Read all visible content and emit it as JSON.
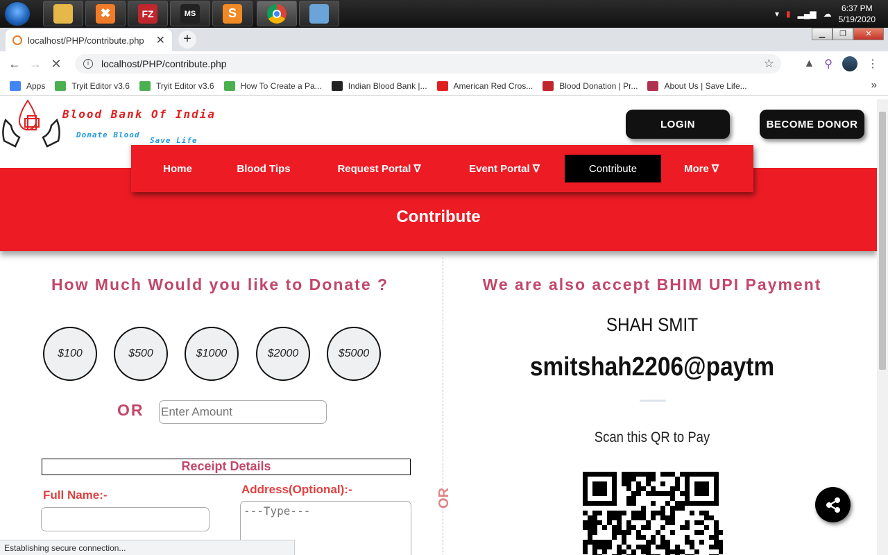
{
  "taskbar": {
    "apps": [
      {
        "name": "file-explorer-icon",
        "color": "#e6b84a"
      },
      {
        "name": "xampp-icon",
        "color": "#f07b28",
        "glyph": "✖"
      },
      {
        "name": "filezilla-icon",
        "color": "#c0272d",
        "glyph": "FZ"
      },
      {
        "name": "msoffice-tc-icon",
        "color": "#222222",
        "glyph": "MS"
      },
      {
        "name": "sublime-text-icon",
        "color": "#3a3a3a",
        "glyph": "S"
      },
      {
        "name": "chrome-icon",
        "color": "#4285f4"
      },
      {
        "name": "paint-icon",
        "color": "#6aa4d8"
      }
    ],
    "time": "6:37 PM",
    "date": "5/19/2020"
  },
  "browser": {
    "tab_title": "localhost/PHP/contribute.php",
    "url": "localhost/PHP/contribute.php",
    "bookmarks": [
      {
        "label": "Apps",
        "icon": "apps-grid-icon",
        "color": "#4285f4"
      },
      {
        "label": "Tryit Editor v3.6",
        "icon": "w3schools-icon",
        "color": "#4caf50"
      },
      {
        "label": "Tryit Editor v3.6",
        "icon": "w3schools-icon",
        "color": "#4caf50"
      },
      {
        "label": "How To Create a Pa...",
        "icon": "w3schools-icon",
        "color": "#4caf50"
      },
      {
        "label": "Indian Blood Bank |...",
        "icon": "linkedin-in-icon",
        "color": "#222222"
      },
      {
        "label": "American Red Cros...",
        "icon": "red-cross-icon",
        "color": "#e02020"
      },
      {
        "label": "Blood Donation | Pr...",
        "icon": "blood-donation-icon",
        "color": "#c0272d"
      },
      {
        "label": "About Us | Save Life...",
        "icon": "savelife-icon",
        "color": "#b03050"
      }
    ],
    "status_text": "Establishing secure connection..."
  },
  "site": {
    "logo_title": "Blood Bank Of India",
    "logo_sub1": "Donate Blood",
    "logo_sub2": "Save Life",
    "login_label": "LOGIN",
    "become_donor_label": "BECOME DONOR",
    "nav": [
      {
        "label": "Home"
      },
      {
        "label": "Blood Tips"
      },
      {
        "label": "Request Portal ∇"
      },
      {
        "label": "Event Portal ∇"
      },
      {
        "label": "Contribute"
      },
      {
        "label": "More ∇"
      }
    ],
    "active_nav": "Contribute",
    "page_title": "Contribute",
    "accent_color": "#ed1c24",
    "heading_color": "#c2476a"
  },
  "donate": {
    "heading": "How Much Would you like to Donate ?",
    "amounts": [
      "$100",
      "$500",
      "$1000",
      "$2000",
      "$5000"
    ],
    "or_label": "OR",
    "amount_placeholder": "Enter Amount",
    "receipt_heading": "Receipt Details",
    "full_name_label": "Full Name:-",
    "address_label": "Address(Optional):-",
    "address_placeholder": "---Type---"
  },
  "divider_or": "OR",
  "upi": {
    "heading": "We are also accept BHIM UPI Payment",
    "name": "SHAH SMIT",
    "id": "smitshah2206@paytm",
    "scan_text": "Scan this QR to Pay"
  }
}
